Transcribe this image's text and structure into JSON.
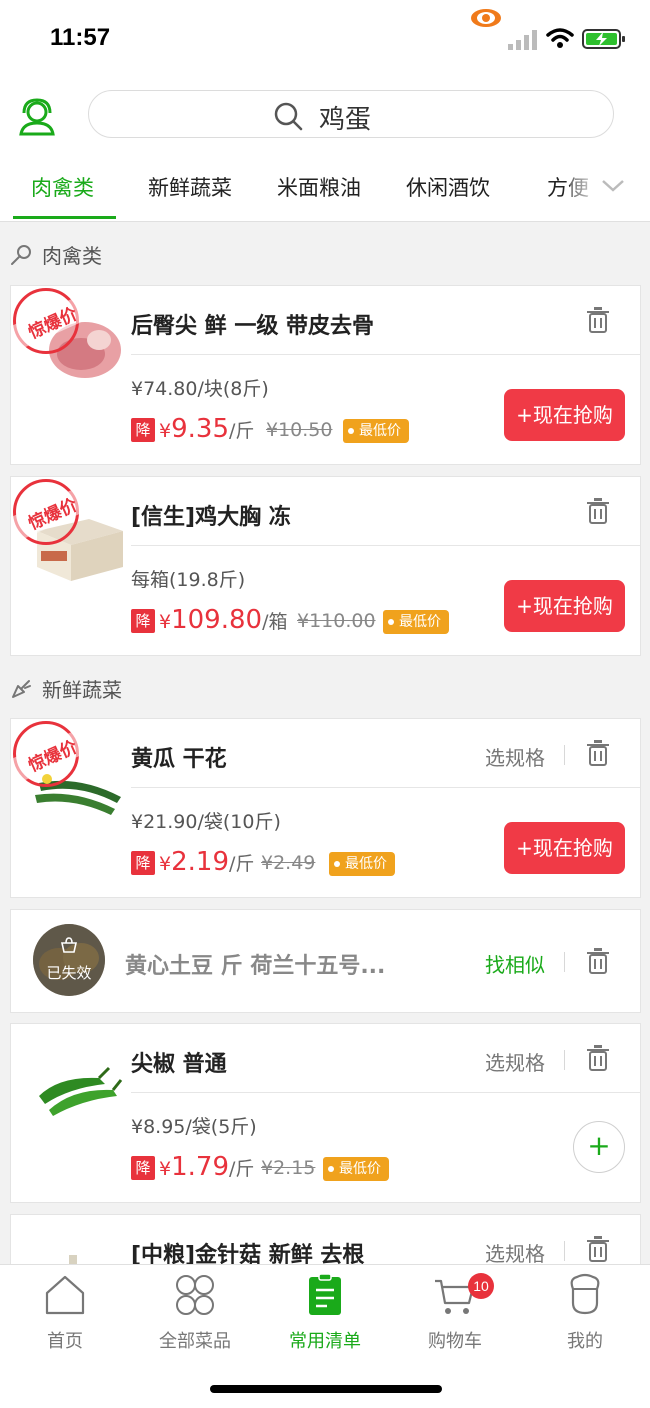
{
  "status_bar": {
    "time": "11:57"
  },
  "search": {
    "query": "鸡蛋"
  },
  "tabs": [
    {
      "label": "肉禽类",
      "active": true
    },
    {
      "label": "新鲜蔬菜",
      "active": false
    },
    {
      "label": "米面粮油",
      "active": false
    },
    {
      "label": "休闲酒饮",
      "active": false
    },
    {
      "label": "方便",
      "active": false
    }
  ],
  "sections": [
    {
      "title": "肉禽类"
    },
    {
      "title": "新鲜蔬菜"
    }
  ],
  "hot_stamp": "惊爆价",
  "drop_badge": "降",
  "lowest_tag": "最低价",
  "buy_label": "+现在抢购",
  "spec_label": "选规格",
  "similar_label": "找相似",
  "invalid_label": "已失效",
  "plus_label": "+",
  "products": [
    {
      "name": "后臀尖 鲜 一级 带皮去骨",
      "unit_price": "¥74.80/块(8斤)",
      "yen": "¥",
      "price": "9.35",
      "price_unit": "/斤",
      "old_price": "¥10.50"
    },
    {
      "name": "[信生]鸡大胸 冻",
      "unit_price": "每箱(19.8斤)",
      "yen": "¥",
      "price": "109.80",
      "price_unit": "/箱",
      "old_price": "¥110.00"
    },
    {
      "name": "黄瓜 干花",
      "unit_price": "¥21.90/袋(10斤)",
      "yen": "¥",
      "price": "2.19",
      "price_unit": "/斤",
      "old_price": "¥2.49"
    },
    {
      "name": "黄心土豆 斤 荷兰十五号..."
    },
    {
      "name": "尖椒 普通",
      "unit_price": "¥8.95/袋(5斤)",
      "yen": "¥",
      "price": "1.79",
      "price_unit": "/斤",
      "old_price": "¥2.15"
    },
    {
      "name": "[中粮]金针菇 新鲜 去根"
    }
  ],
  "bottom_nav": [
    {
      "label": "首页",
      "icon": "home-icon",
      "active": false
    },
    {
      "label": "全部菜品",
      "icon": "all-dishes-icon",
      "active": false
    },
    {
      "label": "常用清单",
      "icon": "list-icon",
      "active": true
    },
    {
      "label": "购物车",
      "icon": "cart-icon",
      "active": false,
      "badge": "10"
    },
    {
      "label": "我的",
      "icon": "profile-icon",
      "active": false
    }
  ],
  "colors": {
    "accent": "#1aaa1a",
    "sale": "#e8323c",
    "tag": "#f0a21d"
  }
}
